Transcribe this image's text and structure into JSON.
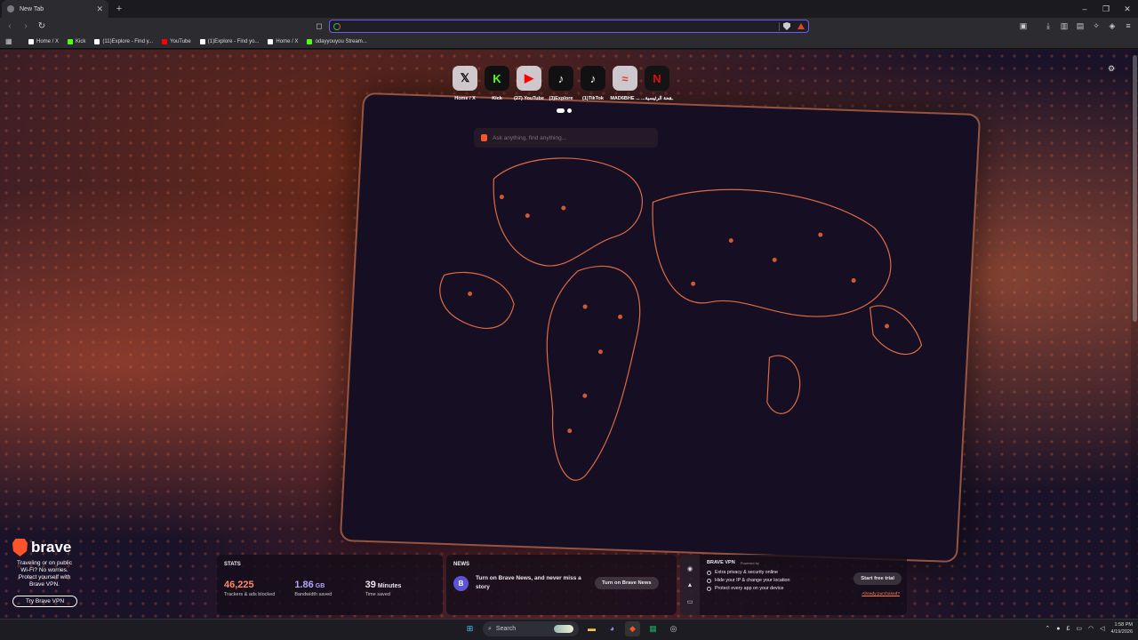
{
  "window": {
    "tab_title": "New Tab",
    "new_tab": "+",
    "minimize": "–",
    "restore": "❐",
    "close": "✕"
  },
  "toolbar": {
    "url_value": "",
    "url_placeholder": ""
  },
  "bookmarks": [
    {
      "label": "Home / X",
      "color": "#ffffff"
    },
    {
      "label": "Kick",
      "color": "#53fc18"
    },
    {
      "label": "(11)Explore - Find y...",
      "color": "#ffffff"
    },
    {
      "label": "YouTube",
      "color": "#ff0000"
    },
    {
      "label": "(1)Explore - Find yo...",
      "color": "#ffffff"
    },
    {
      "label": "Home / X",
      "color": "#ffffff"
    },
    {
      "label": "odayyouyou Stream...",
      "color": "#53fc18"
    }
  ],
  "top_sites": [
    {
      "label": "Home / X",
      "glyph": "𝕏",
      "color": "#000000"
    },
    {
      "label": "Kick",
      "glyph": "K",
      "color": "#53fc18"
    },
    {
      "label": "(27) YouTube",
      "glyph": "▶",
      "color": "#ff0000"
    },
    {
      "label": "(3)Explore",
      "glyph": "♪",
      "color": "#000000"
    },
    {
      "label": "(1)TikTok",
      "glyph": "♪",
      "color": "#000000"
    },
    {
      "label": "MAD6BHE ...",
      "glyph": "≈",
      "color": "#e03c31"
    },
    {
      "label": "...ـقحة الرئيسية",
      "glyph": "N",
      "color": "#e50914"
    }
  ],
  "search": {
    "placeholder": "Ask anything, find anything..."
  },
  "promo": {
    "brand": "brave",
    "text": "Traveling or on public Wi-Fi? No worries. Protect yourself with Brave VPN.",
    "button": "Try Brave VPN"
  },
  "stats": {
    "heading": "STATS",
    "items": [
      {
        "value": "46,225",
        "unit": "",
        "label": "Trackers & ads blocked",
        "color": "#ff8a65"
      },
      {
        "value": "1.86",
        "unit": "GB",
        "label": "Bandwidth saved",
        "color": "#b3a6ff"
      },
      {
        "value": "39",
        "unit": "Minutes",
        "label": "Time saved",
        "color": "#ffffff"
      }
    ]
  },
  "news": {
    "heading": "NEWS",
    "badge": "B",
    "message": "Turn on Brave News, and never miss a story",
    "button": "Turn on Brave News"
  },
  "vpn": {
    "title": "BRAVE VPN",
    "powered": "Powered by",
    "features": [
      "Extra privacy & security online",
      "Hide your IP & change your location",
      "Protect every app on your device"
    ],
    "button": "Start free trial",
    "link": "Already purchased?"
  },
  "taskbar": {
    "search": "Search",
    "time": "1:58 PM",
    "date": "4/19/2026"
  }
}
